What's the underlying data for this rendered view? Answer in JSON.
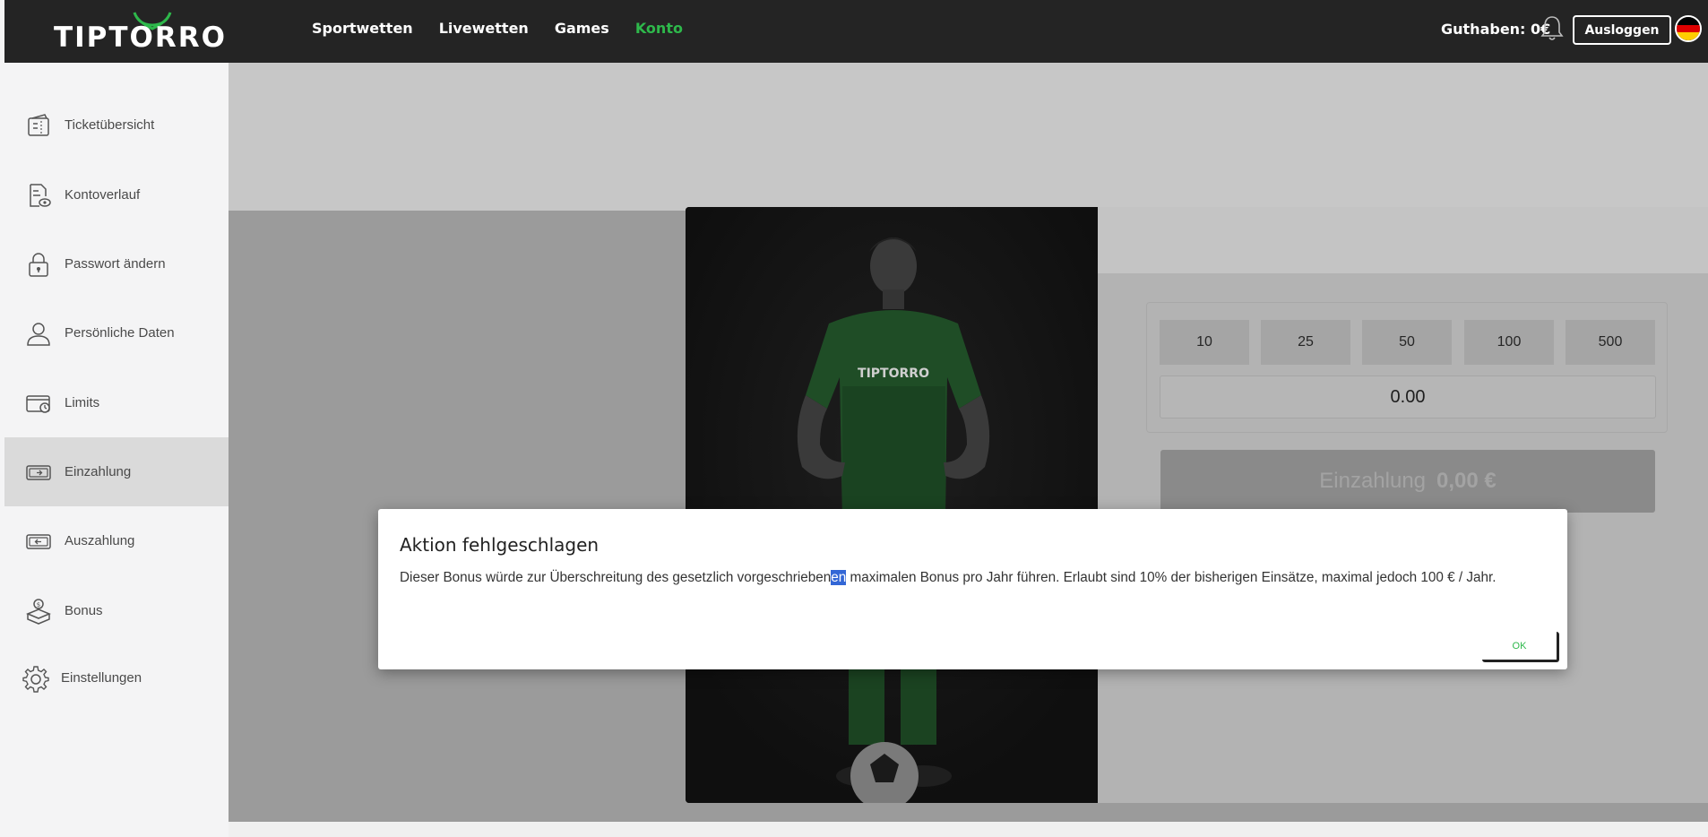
{
  "header": {
    "logo_text": "TIPTORRO",
    "nav": [
      "Sportwetten",
      "Livewetten",
      "Games",
      "Konto"
    ],
    "active_nav": "Konto",
    "balance": "Guthaben: 0€",
    "logout_label": "Ausloggen",
    "language_flag": "german-flag"
  },
  "sidebar": {
    "items": [
      {
        "label": "Ticketübersicht",
        "icon": "ticket-icon"
      },
      {
        "label": "Kontoverlauf",
        "icon": "account-history-icon"
      },
      {
        "label": "Passwort ändern",
        "icon": "lock-icon"
      },
      {
        "label": "Persönliche Daten",
        "icon": "user-icon"
      },
      {
        "label": "Limits",
        "icon": "limits-icon"
      },
      {
        "label": "Einzahlung",
        "icon": "deposit-icon"
      },
      {
        "label": "Auszahlung",
        "icon": "withdrawal-icon"
      },
      {
        "label": "Bonus",
        "icon": "bonus-icon"
      },
      {
        "label": "Einstellungen",
        "icon": "gear-icon"
      }
    ],
    "active": "Einzahlung"
  },
  "deposit": {
    "amounts": [
      "10",
      "25",
      "50",
      "100",
      "500"
    ],
    "input_value": "0.00",
    "button_label": "Einzahlung",
    "button_amount": "0,00 €"
  },
  "modal": {
    "title": "Aktion fehlgeschlagen",
    "message_before": "Dieser Bonus würde zur Überschreitung des gesetzlich vorgeschrieben",
    "message_selected": "en",
    "message_after": " maximalen Bonus pro Jahr führen. Erlaubt sind 10% der bisherigen Einsätze, maximal jedoch 100 € / Jahr.",
    "ok_label": "OK"
  },
  "colors": {
    "accent": "#2eb84b",
    "header_bg": "#242424",
    "selection": "#3367d6"
  }
}
